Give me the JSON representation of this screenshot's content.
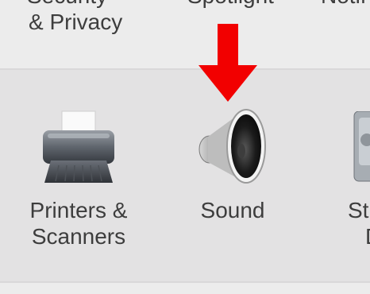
{
  "top_row": {
    "item1_line1": "& Privacy",
    "item2_fragment": "Spotlight",
    "item3_fragment": "Notif"
  },
  "main_row": {
    "printers": {
      "line1": "Printers &",
      "line2": "Scanners"
    },
    "sound": {
      "label": "Sound"
    },
    "startup": {
      "line1": "St",
      "line2": "D"
    }
  },
  "colors": {
    "arrow": "#f20000"
  }
}
